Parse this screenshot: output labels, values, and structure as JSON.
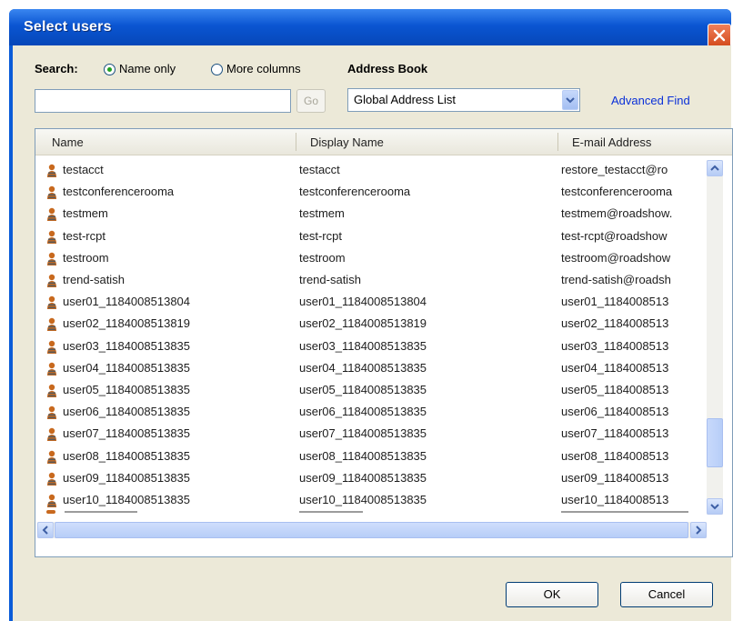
{
  "window": {
    "title": "Select users"
  },
  "search": {
    "label": "Search:",
    "name_only_label": "Name only",
    "more_columns_label": "More columns",
    "selected": "Name only",
    "value": "",
    "go_label": "Go"
  },
  "address_book": {
    "label": "Address Book",
    "selected": "Global Address List",
    "advanced_find_label": "Advanced Find"
  },
  "table": {
    "columns": [
      "Name",
      "Display Name",
      "E-mail Address"
    ],
    "rows": [
      {
        "name": "testacct",
        "display": "testacct",
        "email": "restore_testacct@ro"
      },
      {
        "name": "testconferencerooma",
        "display": "testconferencerooma",
        "email": "testconferenceroomа"
      },
      {
        "name": "testmem",
        "display": "testmem",
        "email": "testmem@roadshow."
      },
      {
        "name": "test-rcpt",
        "display": "test-rcpt",
        "email": "test-rcpt@roadshow"
      },
      {
        "name": "testroom",
        "display": "testroom",
        "email": "testroom@roadshow"
      },
      {
        "name": "trend-satish",
        "display": "trend-satish",
        "email": "trend-satish@roadsh"
      },
      {
        "name": "user01_1184008513804",
        "display": "user01_1184008513804",
        "email": "user01_1184008513"
      },
      {
        "name": "user02_1184008513819",
        "display": "user02_1184008513819",
        "email": "user02_1184008513"
      },
      {
        "name": "user03_1184008513835",
        "display": "user03_1184008513835",
        "email": "user03_1184008513"
      },
      {
        "name": "user04_1184008513835",
        "display": "user04_1184008513835",
        "email": "user04_1184008513"
      },
      {
        "name": "user05_1184008513835",
        "display": "user05_1184008513835",
        "email": "user05_1184008513"
      },
      {
        "name": "user06_1184008513835",
        "display": "user06_1184008513835",
        "email": "user06_1184008513"
      },
      {
        "name": "user07_1184008513835",
        "display": "user07_1184008513835",
        "email": "user07_1184008513"
      },
      {
        "name": "user08_1184008513835",
        "display": "user08_1184008513835",
        "email": "user08_1184008513"
      },
      {
        "name": "user09_1184008513835",
        "display": "user09_1184008513835",
        "email": "user09_1184008513"
      },
      {
        "name": "user10_1184008513835",
        "display": "user10_1184008513835",
        "email": "user10_1184008513"
      }
    ]
  },
  "buttons": {
    "ok": "OK",
    "cancel": "Cancel"
  },
  "colors": {
    "titlebar": "#0a55d2",
    "dialog_bg": "#ece9d8",
    "link": "#0a30d8",
    "user_icon": "#c8691e"
  }
}
